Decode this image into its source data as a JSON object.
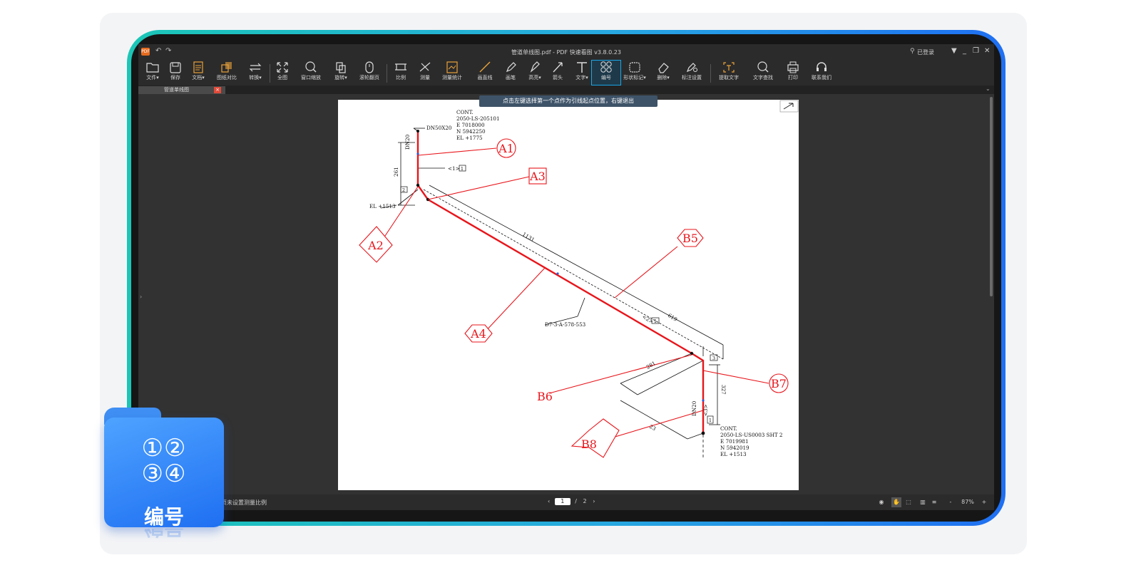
{
  "window": {
    "title": "管道单线图.pdf - PDF 快速看图 v3.8.0.23",
    "login": "已登录"
  },
  "toolbar": [
    {
      "label": "文件▾",
      "icon": "folder-icon"
    },
    {
      "label": "保存",
      "icon": "save-icon"
    },
    {
      "label": "文档▾",
      "icon": "document-icon"
    },
    {
      "label": "图纸对比",
      "icon": "compare-icon"
    },
    {
      "label": "转换▾",
      "icon": "convert-icon"
    },
    {
      "label": "全图",
      "icon": "fit-all-icon"
    },
    {
      "label": "窗口缩放",
      "icon": "zoom-window-icon"
    },
    {
      "label": "旋转▾",
      "icon": "rotate-icon"
    },
    {
      "label": "滚轮翻页",
      "icon": "mouse-wheel-icon"
    },
    {
      "label": "比例",
      "icon": "scale-icon"
    },
    {
      "label": "测量",
      "icon": "measure-icon"
    },
    {
      "label": "测量统计",
      "icon": "measure-stats-icon"
    },
    {
      "label": "画直线",
      "icon": "line-icon"
    },
    {
      "label": "画笔",
      "icon": "pen-icon"
    },
    {
      "label": "高亮▾",
      "icon": "highlight-icon"
    },
    {
      "label": "箭头",
      "icon": "arrow-icon"
    },
    {
      "label": "文字▾",
      "icon": "text-icon"
    },
    {
      "label": "编号",
      "icon": "numbering-icon"
    },
    {
      "label": "形状标记▾",
      "icon": "shape-mark-icon"
    },
    {
      "label": "删除▾",
      "icon": "eraser-icon"
    },
    {
      "label": "标注设置",
      "icon": "annotation-settings-icon"
    },
    {
      "label": "提取文字",
      "icon": "extract-text-icon"
    },
    {
      "label": "文字查找",
      "icon": "search-icon"
    },
    {
      "label": "打印",
      "icon": "print-icon"
    },
    {
      "label": "联系我们",
      "icon": "headset-icon"
    }
  ],
  "tab": {
    "label": "管道单线图",
    "close": "×"
  },
  "hint": "点击左键选择第一个点作为引线起点位置，右键退出",
  "drawing": {
    "top_block": [
      "CONT.",
      "2050-LS-205101",
      "E 7018000",
      "N 5942250",
      "EL +1775"
    ],
    "bottom_block": [
      "CONT.",
      "2050-LS-US0003 SHT 2",
      "E 7019981",
      "N 5942019",
      "EL +1513"
    ],
    "dn_label": "DN50X20",
    "el_label": "EL +1513",
    "line_id": "D7-3-A-578-553",
    "dim_1131": "1131",
    "dim_619": "619",
    "dim_281": "281",
    "dim_261": "261",
    "dim_23": "23",
    "dim_327": "327",
    "dn20_top": "DN20",
    "dn20_bottom": "DN20",
    "weld_1": "<1>",
    "weld_1_box": "1",
    "weld_2": "<2>",
    "weld_2_box": "1",
    "weld_3": "<3>",
    "weld_3_box": "1",
    "box_2": "2",
    "box_3": "3",
    "labels": {
      "A1": "A1",
      "A2": "A2",
      "A3": "A3",
      "A4": "A4",
      "B5": "B5",
      "B6": "B6",
      "B7": "B7",
      "B8": "B8"
    }
  },
  "status": {
    "scale_text": "页未设置测量比例",
    "page_current": "1",
    "page_sep": "/",
    "page_total": "2",
    "zoom": "87%",
    "zoom_minus": "-",
    "zoom_plus": "+"
  },
  "badge": {
    "numbers_top": "①②",
    "numbers_bottom": "③④",
    "label": "编号"
  },
  "colors": {
    "frame_start": "#1bc6b6",
    "frame_end": "#1f6ff2",
    "annotation": "#e8151b",
    "active_tool": "#19a6e8"
  }
}
